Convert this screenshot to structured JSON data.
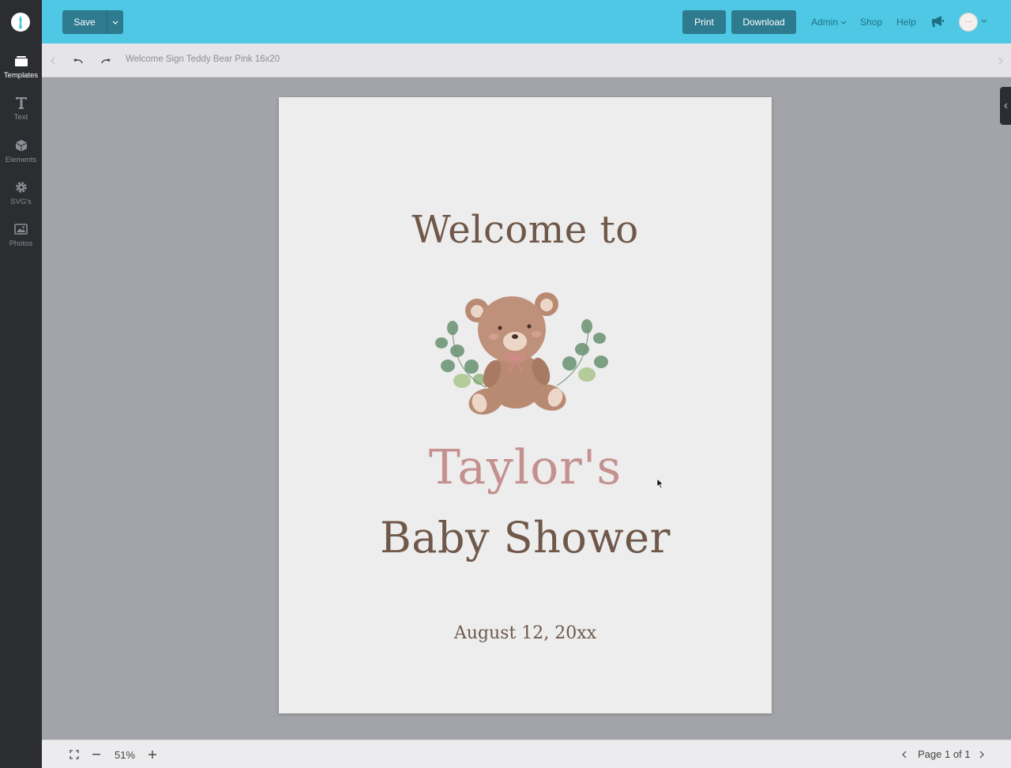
{
  "app": {
    "logo": "app-logo"
  },
  "sidebar": {
    "items": [
      {
        "label": "Templates",
        "icon": "templates-icon"
      },
      {
        "label": "Text",
        "icon": "text-icon"
      },
      {
        "label": "Elements",
        "icon": "cube-icon"
      },
      {
        "label": "SVG's",
        "icon": "gear-icon"
      },
      {
        "label": "Photos",
        "icon": "image-icon"
      }
    ]
  },
  "topbar": {
    "save_label": "Save",
    "print_label": "Print",
    "download_label": "Download",
    "admin_label": "Admin",
    "shop_label": "Shop",
    "help_label": "Help",
    "accent_color": "#4ec8e4",
    "button_color": "#2e7a8e"
  },
  "subbar": {
    "doc_title": "Welcome Sign Teddy Bear Pink 16x20"
  },
  "canvas": {
    "line1": "Welcome to",
    "name": "Taylor's",
    "line3": "Baby Shower",
    "date": "August 12, 20xx",
    "name_color": "#c4918f",
    "text_color": "#6f5849"
  },
  "bottombar": {
    "zoom": "51%",
    "page_indicator": "Page 1 of 1"
  }
}
